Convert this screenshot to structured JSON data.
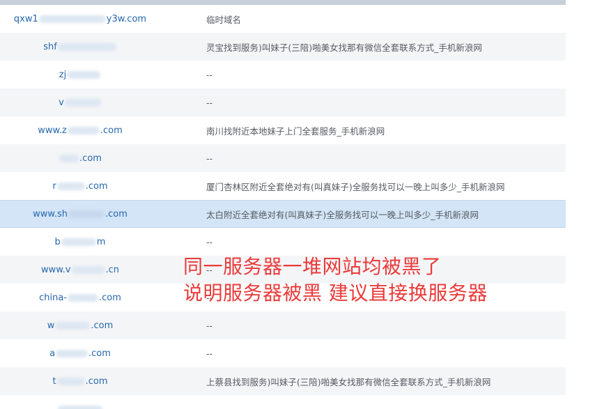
{
  "rows": [
    {
      "d1": "qxw1",
      "d2": "y3w.com",
      "title": "临时域名"
    },
    {
      "d1": "shf",
      "d2": "",
      "title": "灵宝找到服务)叫妹子(三陪)啪美女找那有微信全套联系方式_手机新浪网"
    },
    {
      "d1": "zj",
      "d2": "",
      "title": "--"
    },
    {
      "d1": "v",
      "d2": "",
      "title": "--"
    },
    {
      "d1": "www.z",
      "d2": ".com",
      "title": "南川找附近本地妹子上门全套服务_手机新浪网"
    },
    {
      "d1": "",
      "d2": ".com",
      "title": "--"
    },
    {
      "d1": "r",
      "d2": ".com",
      "title": "厦门杏林区附近全套绝对有(叫真妹子)全服务找可以一晚上叫多少_手机新浪网"
    },
    {
      "d1": "www.sh",
      "d2": ".com",
      "title": "太白附近全套绝对有(叫真妹子)全服务找可以一晚上叫多少_手机新浪网"
    },
    {
      "d1": "b",
      "d2": "m",
      "title": "--"
    },
    {
      "d1": "www.v",
      "d2": ".cn",
      "title": "--"
    },
    {
      "d1": "china-",
      "d2": ".com",
      "title": "--"
    },
    {
      "d1": "w",
      "d2": ".com",
      "title": "--"
    },
    {
      "d1": "a",
      "d2": ".com",
      "title": "--"
    },
    {
      "d1": "t",
      "d2": ".com",
      "title": "上蔡县找到服务)叫妹子(三陪)啪美女找那有微信全套联系方式_手机新浪网"
    }
  ],
  "annotation": {
    "line1": "同一服务器一堆网站均被黑了",
    "line2": "说明服务器被黑 建议直接换服务器"
  },
  "colors": {
    "link": "#2666ad",
    "text": "#555a60",
    "selected_row": "#d3e5f7",
    "annotation": "#ea3a3a"
  }
}
